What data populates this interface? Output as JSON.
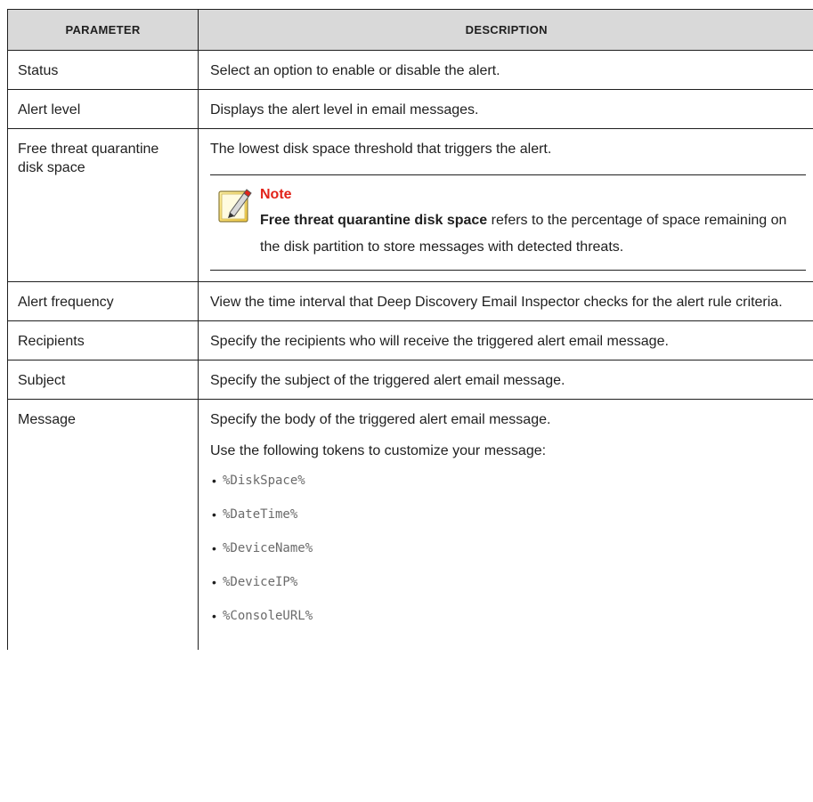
{
  "table": {
    "headers": {
      "parameter": "Parameter",
      "description": "Description"
    },
    "rows": [
      {
        "parameter": "Status",
        "description": "Select an option to enable or disable the alert."
      },
      {
        "parameter": "Alert level",
        "description": "Displays the alert level in email messages."
      },
      {
        "parameter": "Free threat quarantine disk space",
        "description": "The lowest disk space threshold that triggers the alert."
      },
      {
        "parameter": "Alert frequency",
        "description": "View the time interval that Deep Discovery Email Inspector checks for the alert rule criteria."
      },
      {
        "parameter": "Recipients",
        "description": "Specify the recipients who will receive the triggered alert email message."
      },
      {
        "parameter": "Subject",
        "description": "Specify the subject of the triggered alert email message."
      },
      {
        "parameter": "Message",
        "description": "Specify the body of the triggered alert email message."
      }
    ]
  },
  "note": {
    "title": "Note",
    "bold_lead": "Free threat quarantine disk space",
    "text": " refers to the percentage of space remaining on the disk partition to store messages with detected threats.",
    "icon": "note-pencil-icon",
    "title_color": "#e2231a"
  },
  "message": {
    "tokens_intro": "Use the following tokens to customize your message:",
    "tokens": [
      "%DiskSpace%",
      "%DateTime%",
      "%DeviceName%",
      "%DeviceIP%",
      "%ConsoleURL%"
    ]
  }
}
